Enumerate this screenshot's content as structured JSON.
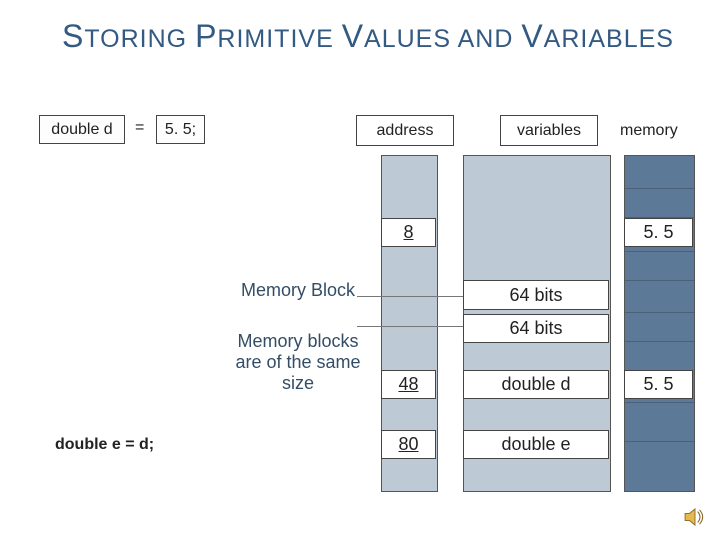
{
  "title_parts": [
    "S",
    "TORING ",
    "P",
    "RIMITIVE ",
    "V",
    "ALUES AND ",
    "V",
    "ARIABLES"
  ],
  "decl_top": {
    "type_var": "double d",
    "eq": "=",
    "value": "5. 5;"
  },
  "headers": {
    "address": "address",
    "variables": "variables",
    "memory": "memory"
  },
  "mem_block_label": "Memory Block",
  "mem_block_note": "Memory blocks are of the same size",
  "rows": {
    "addr_8": "8",
    "addr_48": "48",
    "addr_80": "80",
    "bits_a": "64 bits",
    "bits_b": "64 bits",
    "var_d": "double d",
    "var_e": "double e",
    "mem_55_a": "5. 5",
    "mem_55_b": "5. 5"
  },
  "decl_bottom": "double e  =   d;",
  "icon": "speaker-icon"
}
